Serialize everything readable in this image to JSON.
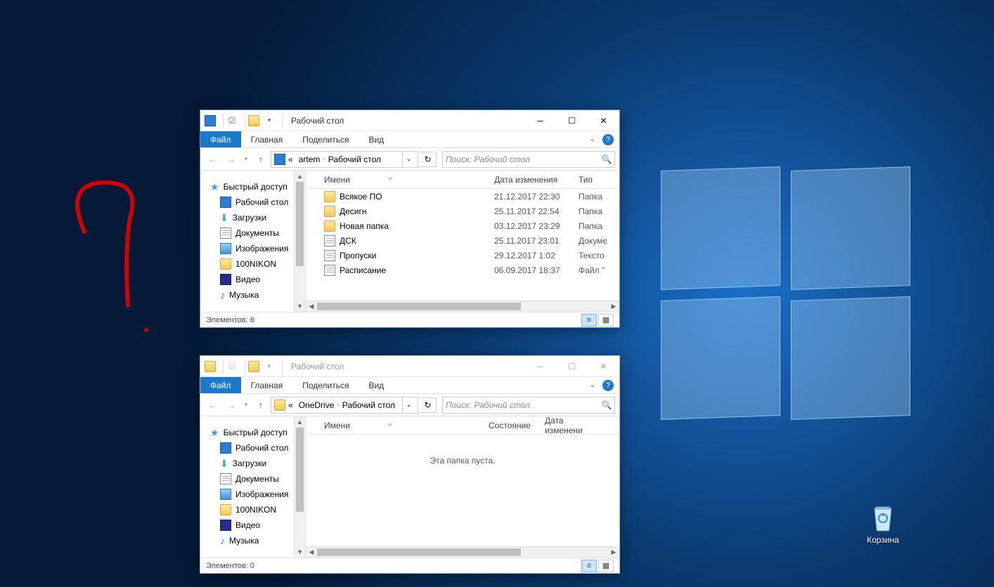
{
  "desktop": {
    "recycle_bin_label": "Корзина"
  },
  "win1": {
    "title": "Рабочий стол",
    "tabs": {
      "file": "Файл",
      "home": "Главная",
      "share": "Поделиться",
      "view": "Вид"
    },
    "breadcrumb": {
      "prefix": "«",
      "p1": "artem",
      "p2": "Рабочий стол"
    },
    "search_placeholder": "Поиск: Рабочий стол",
    "columns": {
      "name": "Имени",
      "date": "Дата изменения",
      "type": "Тип"
    },
    "nav": {
      "quick": "Быстрый доступ",
      "desktop": "Рабочий стол",
      "downloads": "Загрузки",
      "documents": "Документы",
      "pictures": "Изображения",
      "nikon": "100NIKON",
      "video": "Видео",
      "music": "Музыка"
    },
    "files": [
      {
        "name": "Всякое ПО",
        "date": "21.12.2017 22:30",
        "type": "Папка",
        "kind": "folder"
      },
      {
        "name": "Десигн",
        "date": "25.11.2017 22:54",
        "type": "Папка",
        "kind": "folder"
      },
      {
        "name": "Новая папка",
        "date": "03.12.2017 23:29",
        "type": "Папка",
        "kind": "folder"
      },
      {
        "name": "ДСК",
        "date": "25.11.2017 23:01",
        "type": "Докуме",
        "kind": "doc"
      },
      {
        "name": "Пропуски",
        "date": "29.12.2017 1:02",
        "type": "Тексто",
        "kind": "doc"
      },
      {
        "name": "Расписание",
        "date": "06.09.2017 18:37",
        "type": "Файл \"",
        "kind": "doc"
      }
    ],
    "status": "Элементов: 6"
  },
  "win2": {
    "title": "Рабочий стол",
    "tabs": {
      "file": "Файл",
      "home": "Главная",
      "share": "Поделиться",
      "view": "Вид"
    },
    "breadcrumb": {
      "prefix": "«",
      "p1": "OneDrive",
      "p2": "Рабочий стол"
    },
    "search_placeholder": "Поиск: Рабочий стол",
    "columns": {
      "name": "Имени",
      "state": "Состояние",
      "date": "Дата изменени"
    },
    "nav": {
      "quick": "Быстрый доступ",
      "desktop": "Рабочий стол",
      "downloads": "Загрузки",
      "documents": "Документы",
      "pictures": "Изображения",
      "nikon": "100NIKON",
      "video": "Видео",
      "music": "Музыка"
    },
    "empty": "Эта папка пуста.",
    "status": "Элементов: 0"
  }
}
